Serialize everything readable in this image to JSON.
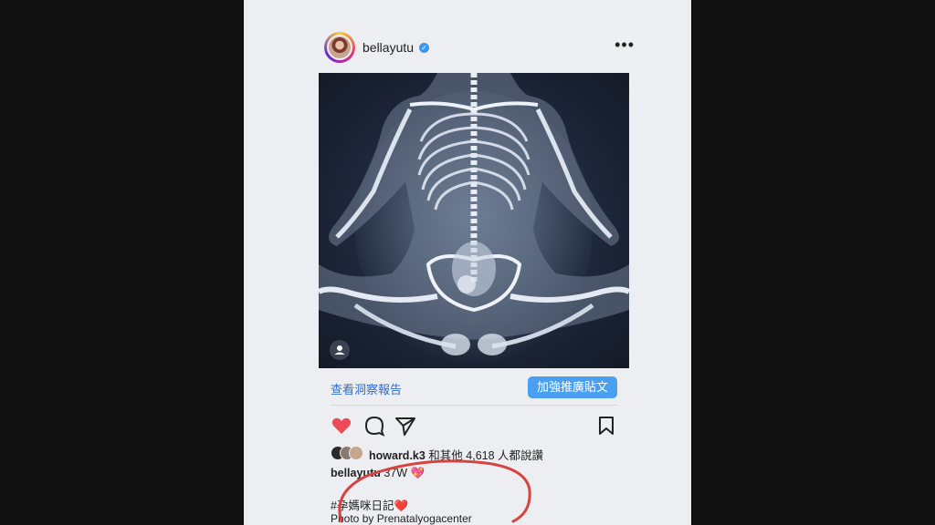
{
  "post": {
    "username": "bellayutu",
    "verified_icon": "verified-badge-icon",
    "more_label": "•••"
  },
  "insights": {
    "link_label": "查看洞察報告",
    "boost_label": "加強推廣貼文"
  },
  "likes": {
    "user": "howard.k3",
    "text": " 和其他 4,618 人都說讚"
  },
  "caption": {
    "user": "bellayutu",
    "text": " 37W 💖"
  },
  "hashtag": "#孕媽咪日記❤️",
  "credit": "Photo by Prenatalyogacenter",
  "colors": {
    "accent": "#3897f0",
    "like": "#ed4956",
    "annotation": "#d9433f"
  }
}
